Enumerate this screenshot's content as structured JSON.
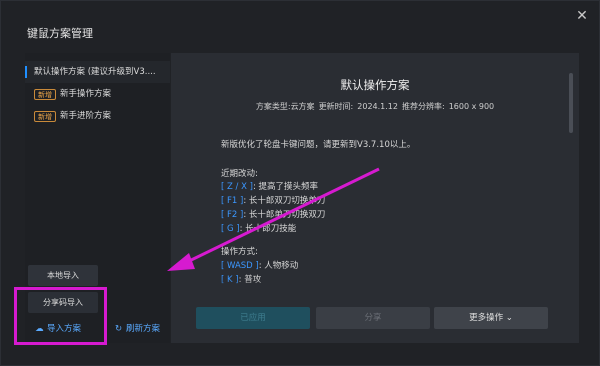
{
  "window": {
    "title": "键鼠方案管理",
    "close_icon": "close-icon"
  },
  "sidebar": {
    "items": [
      {
        "label": "默认操作方案 (建议升级到V3....",
        "active": true
      },
      {
        "badge": "新增",
        "label": "新手操作方案"
      },
      {
        "badge": "新增",
        "label": "新手进阶方案"
      }
    ],
    "local_import": "本地导入",
    "share_code_import": "分享码导入",
    "import_plan": "导入方案",
    "refresh_plan": "刷新方案"
  },
  "main": {
    "title": "默认操作方案",
    "meta": {
      "type_label": "方案类型:",
      "type_value": "云方案",
      "updated_label": "更新时间:",
      "updated_value": "2024.1.12",
      "resolution_label": "推荐分辨率:",
      "resolution_value": "1600 x 900"
    },
    "notice": "新版优化了轮盘卡键问题，请更新到V3.7.10以上。",
    "recent_heading": "近期改动:",
    "recent": [
      {
        "key": "[ Z / X ]",
        "text": ": 提高了摸头频率"
      },
      {
        "key": "[ F1 ]",
        "text": ": 长十郎双刀切换单刀"
      },
      {
        "key": "[ F2 ]",
        "text": ": 长十郎单刀切换双刀"
      },
      {
        "key": "[ G ]",
        "text": ": 长十郎刀技能"
      }
    ],
    "ops_heading": "操作方式:",
    "ops": [
      {
        "key": "[ WASD ]",
        "text": ": 人物移动"
      },
      {
        "key": "[ K ]",
        "text": ": 普攻"
      }
    ],
    "buttons": {
      "applied": "已应用",
      "share": "分享",
      "more": "更多操作"
    }
  },
  "colors": {
    "accent": "#1f8fff",
    "badge": "#f0a84a",
    "highlight": "#d61ad0"
  }
}
